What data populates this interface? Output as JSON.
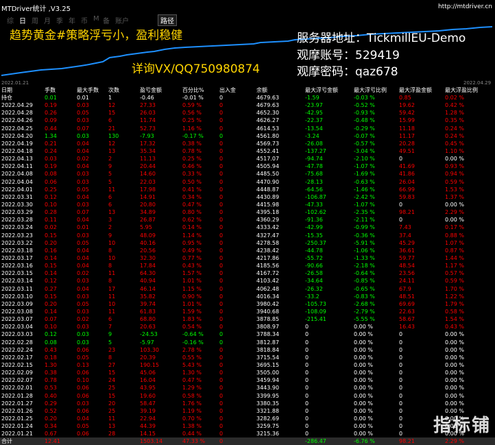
{
  "window": {
    "title": "MTDriver统计 ,V3.25",
    "site": "http://mtdriver.cn"
  },
  "tabs": [
    "综",
    "日",
    "周",
    "月",
    "季",
    "年",
    "币",
    "M",
    "备",
    "账户",
    "路径"
  ],
  "active_tab": "日",
  "ads": {
    "strategy": "趋势黄金#策略浮亏小，盈利稳健",
    "server": "服务器地址：TickmillEU-Demo",
    "account": "观摩账号：529419",
    "password": "观摩密码：qaz678",
    "contact": "详询VX/QQ750980874"
  },
  "chart": {
    "date_start": "2022.01.21",
    "date_end": "2022.04.29",
    "line_color": "#1e90ff"
  },
  "columns": [
    "日期",
    "手数",
    "最大手数",
    "次数",
    "盈亏金额",
    "百分比%",
    "出入金",
    "余额",
    "最大浮亏金额",
    "最大浮亏比例",
    "最大浮盈金额",
    "最大浮盈比例"
  ],
  "holding": [
    "持仓",
    "0.01",
    "0.01",
    "1",
    "-0.46",
    "-0.01 %",
    "0",
    "4679.63",
    "-1.59",
    "-0.03 %",
    "0.85",
    "0.02 %"
  ],
  "rows": [
    [
      "2022.04.29",
      "0.19",
      "0.03",
      "12",
      "27.33",
      "0.59 %",
      "0",
      "4679.63",
      "-23.97",
      "-0.52 %",
      "19.62",
      "0.42 %"
    ],
    [
      "2022.04.28",
      "0.26",
      "0.05",
      "15",
      "26.03",
      "0.56 %",
      "0",
      "4652.30",
      "-42.95",
      "-0.93 %",
      "59.42",
      "1.28 %"
    ],
    [
      "2022.04.26",
      "0.09",
      "0.03",
      "6",
      "11.74",
      "0.25 %",
      "0",
      "4626.27",
      "-22.37",
      "-0.48 %",
      "15.99",
      "0.35 %"
    ],
    [
      "2022.04.25",
      "0.44",
      "0.07",
      "21",
      "52.73",
      "1.16 %",
      "0",
      "4614.53",
      "-13.54",
      "-0.29 %",
      "11.18",
      "0.24 %"
    ],
    [
      "2022.04.20",
      "1.34",
      "0.03",
      "130",
      "-7.93",
      "-0.17 %",
      "0",
      "4561.80",
      "-3.24",
      "-0.07 %",
      "11.17",
      "0.24 %"
    ],
    [
      "2022.04.19",
      "0.21",
      "0.04",
      "12",
      "17.32",
      "0.38 %",
      "0",
      "4569.73",
      "-26.08",
      "-0.57 %",
      "20.28",
      "0.45 %"
    ],
    [
      "2022.04.18",
      "0.24",
      "0.04",
      "13",
      "35.34",
      "0.78 %",
      "0",
      "4552.41",
      "-137.27",
      "-3.04 %",
      "49.51",
      "1.10 %"
    ],
    [
      "2022.04.13",
      "0.03",
      "0.02",
      "2",
      "11.13",
      "0.25 %",
      "0",
      "4517.07",
      "-94.74",
      "-2.10 %",
      "0",
      "0.00 %"
    ],
    [
      "2022.04.11",
      "0.19",
      "0.04",
      "9",
      "20.44",
      "0.46 %",
      "0",
      "4505.94",
      "-47.78",
      "-1.07 %",
      "41.69",
      "0.93 %"
    ],
    [
      "2022.04.08",
      "0.08",
      "0.03",
      "5",
      "14.60",
      "0.33 %",
      "0",
      "4485.50",
      "-75.68",
      "-1.69 %",
      "41.86",
      "0.94 %"
    ],
    [
      "2022.04.04",
      "0.06",
      "0.03",
      "5",
      "22.03",
      "0.50 %",
      "0",
      "4470.90",
      "-28.13",
      "-0.63 %",
      "26.04",
      "0.59 %"
    ],
    [
      "2022.04.01",
      "0.25",
      "0.05",
      "11",
      "17.98",
      "0.41 %",
      "0",
      "4448.87",
      "-64.56",
      "-1.46 %",
      "66.99",
      "1.53 %"
    ],
    [
      "2022.03.31",
      "0.12",
      "0.04",
      "6",
      "14.91",
      "0.34 %",
      "0",
      "4430.89",
      "-106.87",
      "-2.42 %",
      "59.83",
      "1.37 %"
    ],
    [
      "2022.03.30",
      "0.10",
      "0.03",
      "6",
      "20.80",
      "0.47 %",
      "0",
      "4415.98",
      "-47.33",
      "-1.07 %",
      "0",
      "0.00 %"
    ],
    [
      "2022.03.29",
      "0.28",
      "0.07",
      "13",
      "34.89",
      "0.80 %",
      "0",
      "4395.18",
      "-102.62",
      "-2.35 %",
      "98.21",
      "2.29 %"
    ],
    [
      "2022.03.28",
      "0.11",
      "0.04",
      "3",
      "26.87",
      "0.62 %",
      "0",
      "4360.29",
      "-91.36",
      "-2.11 %",
      "0",
      "0.00 %"
    ],
    [
      "2022.03.24",
      "0.02",
      "0.01",
      "2",
      "5.95",
      "0.14 %",
      "0",
      "4333.42",
      "-42.99",
      "-0.99 %",
      "7.43",
      "0.17 %"
    ],
    [
      "2022.03.23",
      "0.15",
      "0.03",
      "9",
      "48.09",
      "1.14 %",
      "0",
      "4327.47",
      "-15.35",
      "-0.36 %",
      "37.4",
      "0.88 %"
    ],
    [
      "2022.03.22",
      "0.20",
      "0.05",
      "10",
      "40.16",
      "0.95 %",
      "0",
      "4278.58",
      "-250.37",
      "-5.91 %",
      "45.29",
      "1.07 %"
    ],
    [
      "2022.03.18",
      "0.16",
      "0.04",
      "8",
      "20.56",
      "0.49 %",
      "0",
      "4238.42",
      "-44.78",
      "-1.06 %",
      "36.61",
      "0.87 %"
    ],
    [
      "2022.03.17",
      "0.14",
      "0.04",
      "10",
      "32.30",
      "0.77 %",
      "0",
      "4217.86",
      "-55.72",
      "-1.33 %",
      "59.77",
      "1.44 %"
    ],
    [
      "2022.03.16",
      "0.15",
      "0.04",
      "8",
      "17.84",
      "0.43 %",
      "0",
      "4185.56",
      "-90.66",
      "-2.18 %",
      "48.54",
      "1.17 %"
    ],
    [
      "2022.03.15",
      "0.14",
      "0.02",
      "11",
      "64.30",
      "1.57 %",
      "0",
      "4167.72",
      "-26.58",
      "-0.64 %",
      "23.56",
      "0.57 %"
    ],
    [
      "2022.03.14",
      "0.12",
      "0.03",
      "8",
      "40.94",
      "1.01 %",
      "0",
      "4103.42",
      "-34.64",
      "-0.85 %",
      "24.11",
      "0.59 %"
    ],
    [
      "2022.03.11",
      "0.27",
      "0.04",
      "17",
      "46.14",
      "1.15 %",
      "0",
      "4062.48",
      "-26.32",
      "-0.65 %",
      "67.9",
      "1.70 %"
    ],
    [
      "2022.03.10",
      "0.15",
      "0.03",
      "11",
      "35.82",
      "0.90 %",
      "0",
      "4016.34",
      "-33.2",
      "-0.83 %",
      "48.51",
      "1.22 %"
    ],
    [
      "2022.03.09",
      "0.20",
      "0.05",
      "10",
      "39.74",
      "1.01 %",
      "0",
      "3980.42",
      "-105.73",
      "-2.68 %",
      "69.69",
      "1.79 %"
    ],
    [
      "2022.03.08",
      "0.14",
      "0.03",
      "11",
      "61.83",
      "1.59 %",
      "0",
      "3940.68",
      "-108.09",
      "-2.79 %",
      "22.63",
      "0.58 %"
    ],
    [
      "2022.03.07",
      "0.07",
      "0.02",
      "6",
      "68.80",
      "1.83 %",
      "0",
      "3878.85",
      "-215.41",
      "-5.55 %",
      "58.67",
      "1.54 %"
    ],
    [
      "2022.03.04",
      "0.10",
      "0.03",
      "7",
      "20.63",
      "0.54 %",
      "0",
      "3808.97",
      "0",
      "0.00 %",
      "16.43",
      "0.43 %"
    ],
    [
      "2022.03.03",
      "0.12",
      "0.03",
      "9",
      "-24.53",
      "-0.64 %",
      "0",
      "3788.34",
      "0",
      "0.00 %",
      "0",
      "0.00 %"
    ],
    [
      "2022.02.28",
      "0.08",
      "0.03",
      "5",
      "-5.97",
      "-0.16 %",
      "0",
      "3812.87",
      "0",
      "0.00 %",
      "0",
      "0.00 %"
    ],
    [
      "2022.02.24",
      "0.43",
      "0.06",
      "23",
      "103.30",
      "2.78 %",
      "0",
      "3818.84",
      "0",
      "0.00 %",
      "0",
      "0.00 %"
    ],
    [
      "2022.02.17",
      "0.18",
      "0.05",
      "8",
      "20.39",
      "0.55 %",
      "0",
      "3715.54",
      "0",
      "0.00 %",
      "0",
      "0.00 %"
    ],
    [
      "2022.02.15",
      "1.30",
      "0.13",
      "27",
      "190.15",
      "5.43 %",
      "0",
      "3695.15",
      "0",
      "0.00 %",
      "0",
      "0.00 %"
    ],
    [
      "2022.02.09",
      "0.38",
      "0.06",
      "15",
      "45.06",
      "1.30 %",
      "0",
      "3505.00",
      "0",
      "0.00 %",
      "0",
      "0.00 %"
    ],
    [
      "2022.02.07",
      "0.78",
      "0.10",
      "24",
      "16.04",
      "0.47 %",
      "0",
      "3459.94",
      "0",
      "0.00 %",
      "0",
      "0.00 %"
    ],
    [
      "2022.02.01",
      "0.53",
      "0.06",
      "25",
      "43.95",
      "1.29 %",
      "0",
      "3443.90",
      "0",
      "0.00 %",
      "0",
      "0.00 %"
    ],
    [
      "2022.01.28",
      "0.40",
      "0.06",
      "15",
      "19.60",
      "0.58 %",
      "0",
      "3399.95",
      "0",
      "0.00 %",
      "0",
      "0.00 %"
    ],
    [
      "2022.01.27",
      "0.29",
      "0.03",
      "20",
      "58.47",
      "1.76 %",
      "0",
      "3380.35",
      "0",
      "0.00 %",
      "0",
      "0.00 %"
    ],
    [
      "2022.01.26",
      "0.52",
      "0.06",
      "25",
      "39.19",
      "1.19 %",
      "0",
      "3321.88",
      "0",
      "0.00 %",
      "0",
      "0.00 %"
    ],
    [
      "2022.01.25",
      "0.20",
      "0.04",
      "11",
      "22.94",
      "0.70 %",
      "0",
      "3282.69",
      "0",
      "0.00 %",
      "0",
      "0.00 %"
    ],
    [
      "2022.01.24",
      "0.34",
      "0.05",
      "13",
      "44.39",
      "1.38 %",
      "0",
      "3259.75",
      "0",
      "0.00 %",
      "0",
      "0.00 %"
    ],
    [
      "2022.01.21",
      "0.67",
      "0.06",
      "28",
      "14.15",
      "0.44 %",
      "0",
      "3215.36",
      "0",
      "0.00 %",
      "0",
      "0.00 %"
    ]
  ],
  "total": [
    "合计",
    "12.41",
    "",
    "",
    "1503.14",
    "47.33 %",
    "0",
    "",
    "-286.47",
    "-6.76 %",
    "98.21",
    "2.29 %"
  ],
  "watermark": "指标铺"
}
